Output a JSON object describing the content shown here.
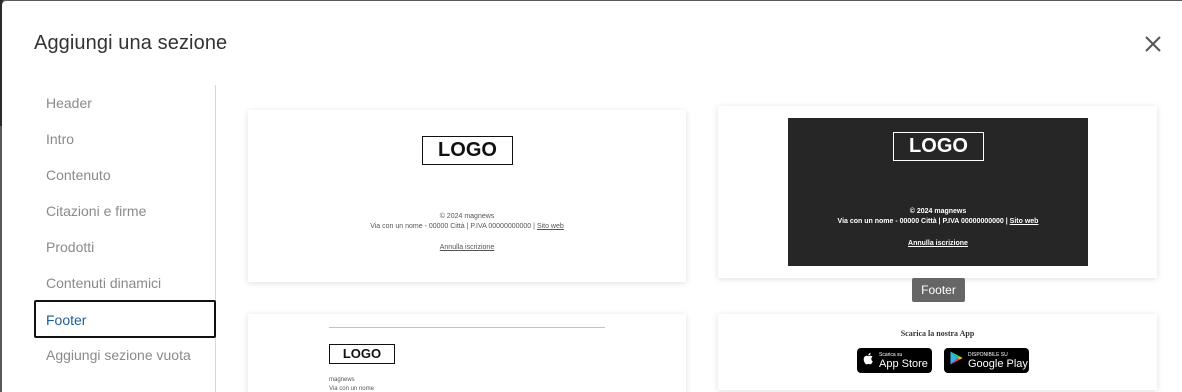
{
  "dialog": {
    "title": "Aggiungi una sezione"
  },
  "sidebar": {
    "items": [
      {
        "label": "Header"
      },
      {
        "label": "Intro"
      },
      {
        "label": "Contenuto"
      },
      {
        "label": "Citazioni e firme"
      },
      {
        "label": "Prodotti"
      },
      {
        "label": "Contenuti dinamici"
      },
      {
        "label": "Footer",
        "active": true
      },
      {
        "label": "Aggiungi sezione vuota"
      }
    ]
  },
  "templates": {
    "footer_light": {
      "logo": "LOGO",
      "copyright": "© 2024 magnews",
      "address": "Via con un nome - 00000 Città | P.IVA 00000000000 |",
      "website_link": "Sito web",
      "unsubscribe": "Annulla iscrizione"
    },
    "footer_dark": {
      "logo": "LOGO",
      "copyright": "© 2024 magnews",
      "address": "Via con un nome - 00000 Città | P.IVA 00000000000 |",
      "website_link": "Sito web",
      "unsubscribe": "Annulla iscrizione",
      "tooltip": "Footer"
    },
    "footer_left": {
      "logo": "LOGO",
      "company": "magnews",
      "address": "Via con un nome"
    },
    "footer_app": {
      "heading": "Scarica la nostra App",
      "app_store_small": "Scarica su",
      "app_store_big": "App Store",
      "google_play_small": "DISPONIBILE SU",
      "google_play_big": "Google Play"
    }
  },
  "colors": {
    "active_text": "#1f5c99",
    "muted_text": "#8a8a8a",
    "dark_panel": "#262626",
    "accent_line": "#e8c170"
  }
}
